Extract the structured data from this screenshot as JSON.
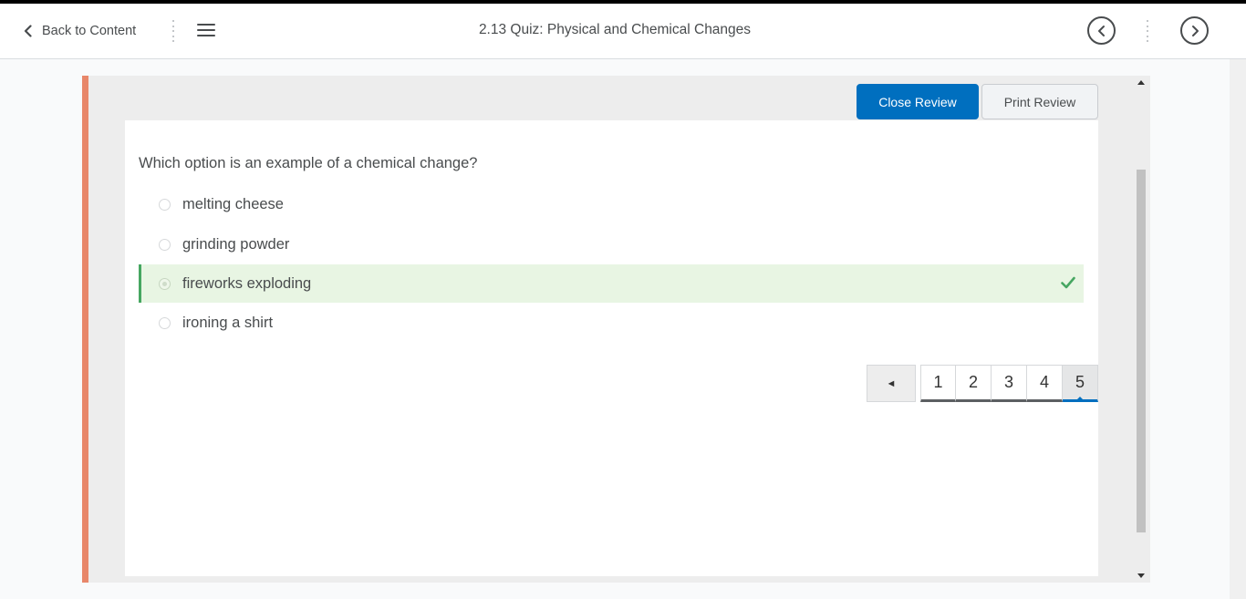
{
  "nav": {
    "back_label": "Back to Content",
    "title": "2.13 Quiz: Physical and Chemical Changes"
  },
  "review": {
    "close_label": "Close Review",
    "print_label": "Print Review"
  },
  "question": {
    "text": "Which option is an example of a chemical change?",
    "options": [
      {
        "label": "melting cheese",
        "correct": false
      },
      {
        "label": "grinding powder",
        "correct": false
      },
      {
        "label": "fireworks exploding",
        "correct": true
      },
      {
        "label": "ironing a shirt",
        "correct": false
      }
    ]
  },
  "pagination": {
    "prev_symbol": "◄",
    "pages": [
      "1",
      "2",
      "3",
      "4",
      "5"
    ],
    "current": "5"
  },
  "colors": {
    "accent": "#e8876a",
    "primary": "#006fbf",
    "correct_bg": "#e8f5e3",
    "correct_mark": "#46a661"
  },
  "icons": {
    "back": "chevron-left-icon",
    "menu": "hamburger-menu-icon",
    "prev": "circle-chevron-left-icon",
    "next": "circle-chevron-right-icon",
    "correct": "checkmark-icon"
  }
}
